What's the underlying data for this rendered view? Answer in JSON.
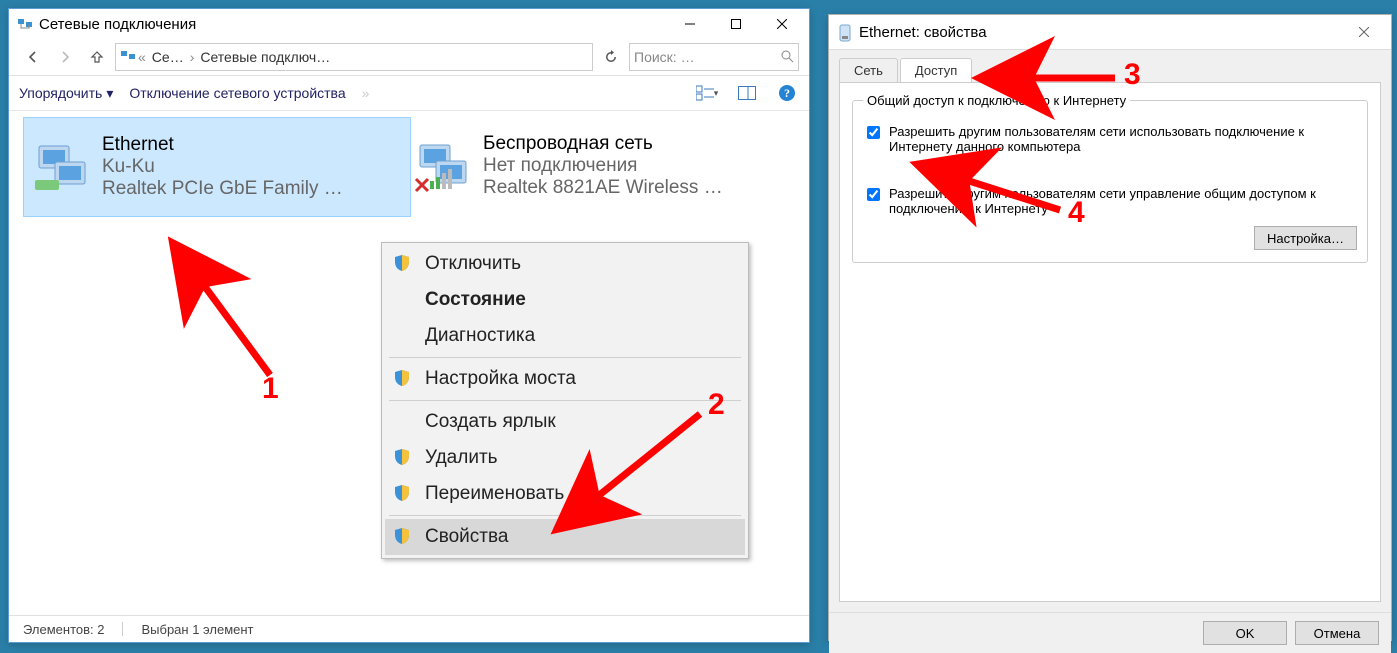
{
  "win1": {
    "title": "Сетевые подключения",
    "addr_seg1": "Се…",
    "addr_seg2": "Сетевые подключ…",
    "search_ph": "Поиск: …",
    "toolbar": {
      "organize": "Упорядочить",
      "disable": "Отключение сетевого устройства"
    },
    "conn1": {
      "name": "Ethernet",
      "status": "Ku-Ku",
      "device": "Realtek PCIe GbE Family …"
    },
    "conn2": {
      "name": "Беспроводная сеть",
      "status": "Нет подключения",
      "device": "Realtek 8821AE Wireless …"
    },
    "status": {
      "count": "Элементов: 2",
      "selected": "Выбран 1 элемент"
    }
  },
  "ctx": {
    "disable": "Отключить",
    "state": "Состояние",
    "diag": "Диагностика",
    "bridge": "Настройка моста",
    "shortcut": "Создать ярлык",
    "delete": "Удалить",
    "rename": "Переименовать",
    "props": "Свойства"
  },
  "dlg": {
    "title": "Ethernet: свойства",
    "tabs": {
      "net": "Сеть",
      "access": "Доступ"
    },
    "group_legend": "Общий доступ к подключению к Интернету",
    "chk1": "Разрешить другим пользователям сети использовать подключение к Интернету данного компьютера",
    "chk2": "Разрешить другим пользователям сети управление общим доступом к подключению к Интернету",
    "settings_btn": "Настройка…",
    "ok": "OK",
    "cancel": "Отмена"
  },
  "anno": {
    "n1": "1",
    "n2": "2",
    "n3": "3",
    "n4": "4"
  }
}
